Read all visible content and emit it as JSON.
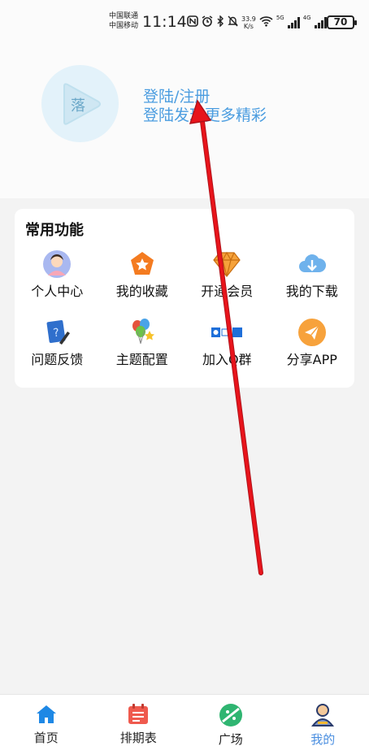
{
  "status_bar": {
    "carrier1": "中国联通",
    "carrier2": "中国移动",
    "time": "11:14",
    "speed_value": "33.9",
    "speed_unit": "K/s",
    "net1": "5G",
    "net2": "4G",
    "battery": "70"
  },
  "profile": {
    "logo_text": "落",
    "login_title": "登陆/注册",
    "login_subtitle": "登陆发现更多精彩"
  },
  "functions": {
    "title": "常用功能",
    "items": [
      {
        "label": "个人中心",
        "icon": "avatar-icon"
      },
      {
        "label": "我的收藏",
        "icon": "star-icon"
      },
      {
        "label": "开通会员",
        "icon": "diamond-icon"
      },
      {
        "label": "我的下载",
        "icon": "cloud-download-icon"
      },
      {
        "label": "问题反馈",
        "icon": "feedback-icon"
      },
      {
        "label": "主题配置",
        "icon": "balloons-icon"
      },
      {
        "label": "加入Q群",
        "icon": "qq-group-icon"
      },
      {
        "label": "分享APP",
        "icon": "share-icon"
      }
    ]
  },
  "nav": {
    "tabs": [
      {
        "label": "首页",
        "icon": "home-icon"
      },
      {
        "label": "排期表",
        "icon": "calendar-icon"
      },
      {
        "label": "广场",
        "icon": "plaza-icon"
      },
      {
        "label": "我的",
        "icon": "user-icon"
      }
    ],
    "active_tab": "我的"
  },
  "colors": {
    "accent": "#4b9de0",
    "annotation_arrow": "#e8141b"
  }
}
